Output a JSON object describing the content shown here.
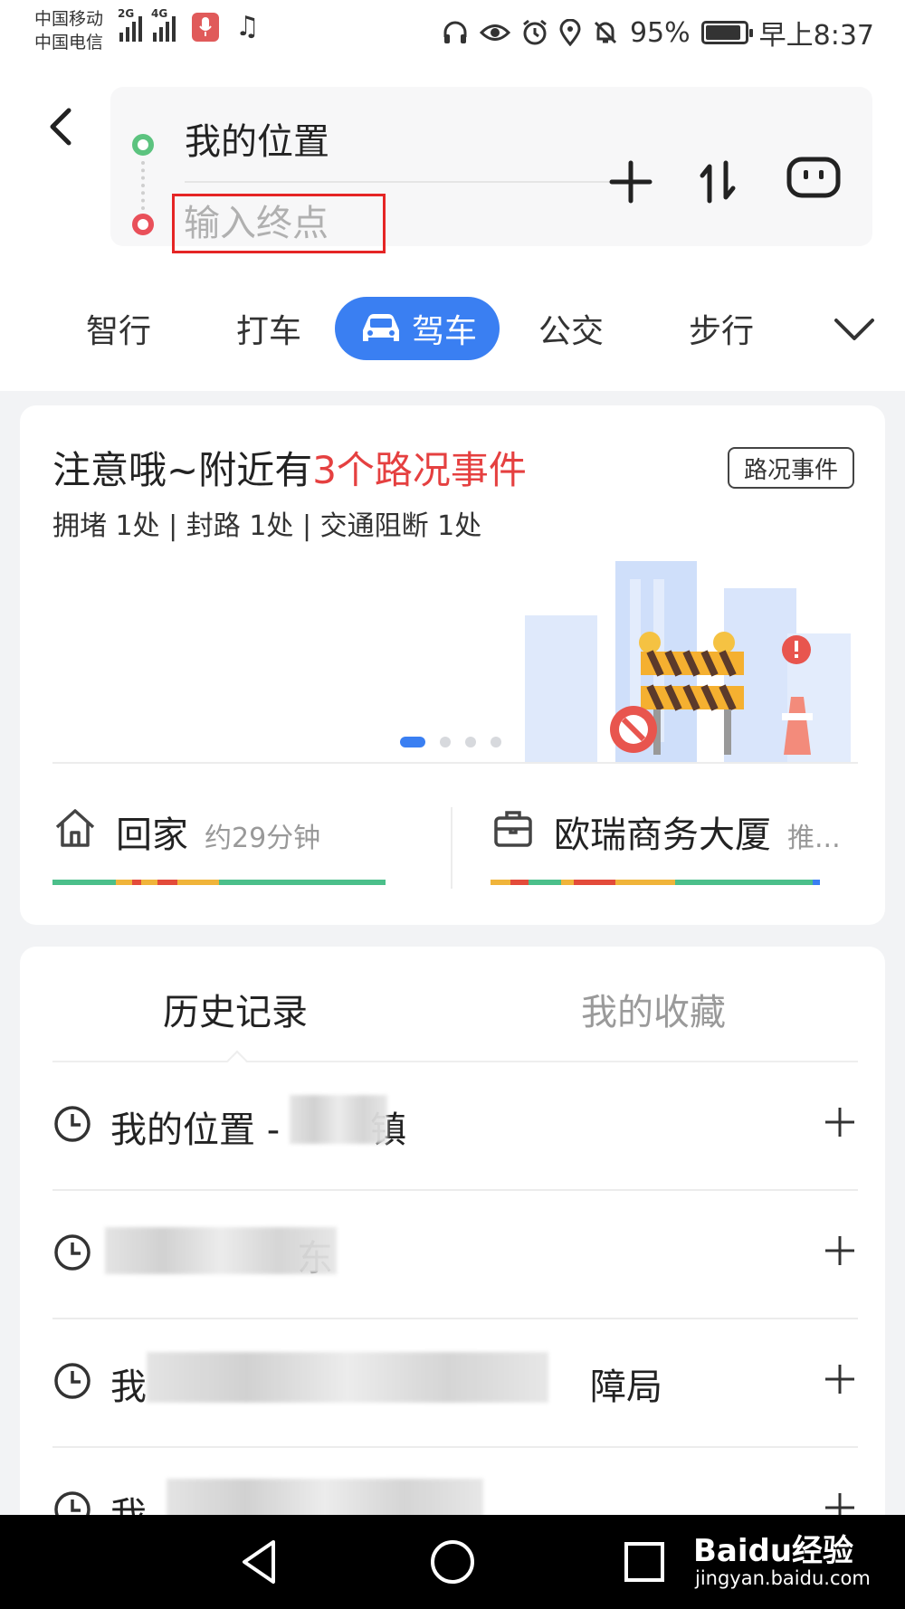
{
  "status_bar": {
    "carrier_1": "中国移动",
    "carrier_2": "中国电信",
    "net_1": "2G",
    "net_2": "4G",
    "battery": "95%",
    "time": "早上8:37"
  },
  "route": {
    "start": "我的位置",
    "end_placeholder": "输入终点"
  },
  "modes": [
    {
      "label": "智行"
    },
    {
      "label": "打车"
    },
    {
      "label": "驾车"
    },
    {
      "label": "公交"
    },
    {
      "label": "步行"
    }
  ],
  "traffic_card": {
    "title_prefix": "注意哦~附近有",
    "title_highlight": "3个路况事件",
    "tag": "路况事件",
    "summary": "拥堵 1处 | 封路 1处 | 交通阻断 1处",
    "pager": {
      "pages": 4,
      "active": 1
    }
  },
  "shortcuts": {
    "home": {
      "label": "回家",
      "meta": "约29分钟"
    },
    "office": {
      "label": "欧瑞商务大厦",
      "meta": "推..."
    }
  },
  "history": {
    "tab_history": "历史记录",
    "tab_favorites": "我的收藏",
    "rows": [
      {
        "prefix": "我的位置 -",
        "suffix": "镇"
      },
      {
        "prefix": "",
        "suffix": "东"
      },
      {
        "prefix": "我",
        "suffix": "障局"
      },
      {
        "prefix": "我",
        "suffix": ""
      }
    ]
  },
  "watermark": {
    "brand": "Baidu经验",
    "url": "jingyan.baidu.com"
  },
  "colors": {
    "accent": "#3a7ff2",
    "alert": "#e54040",
    "highlight_box": "#e52525",
    "start_dot": "#5cc37f",
    "end_dot": "#e9505a"
  }
}
